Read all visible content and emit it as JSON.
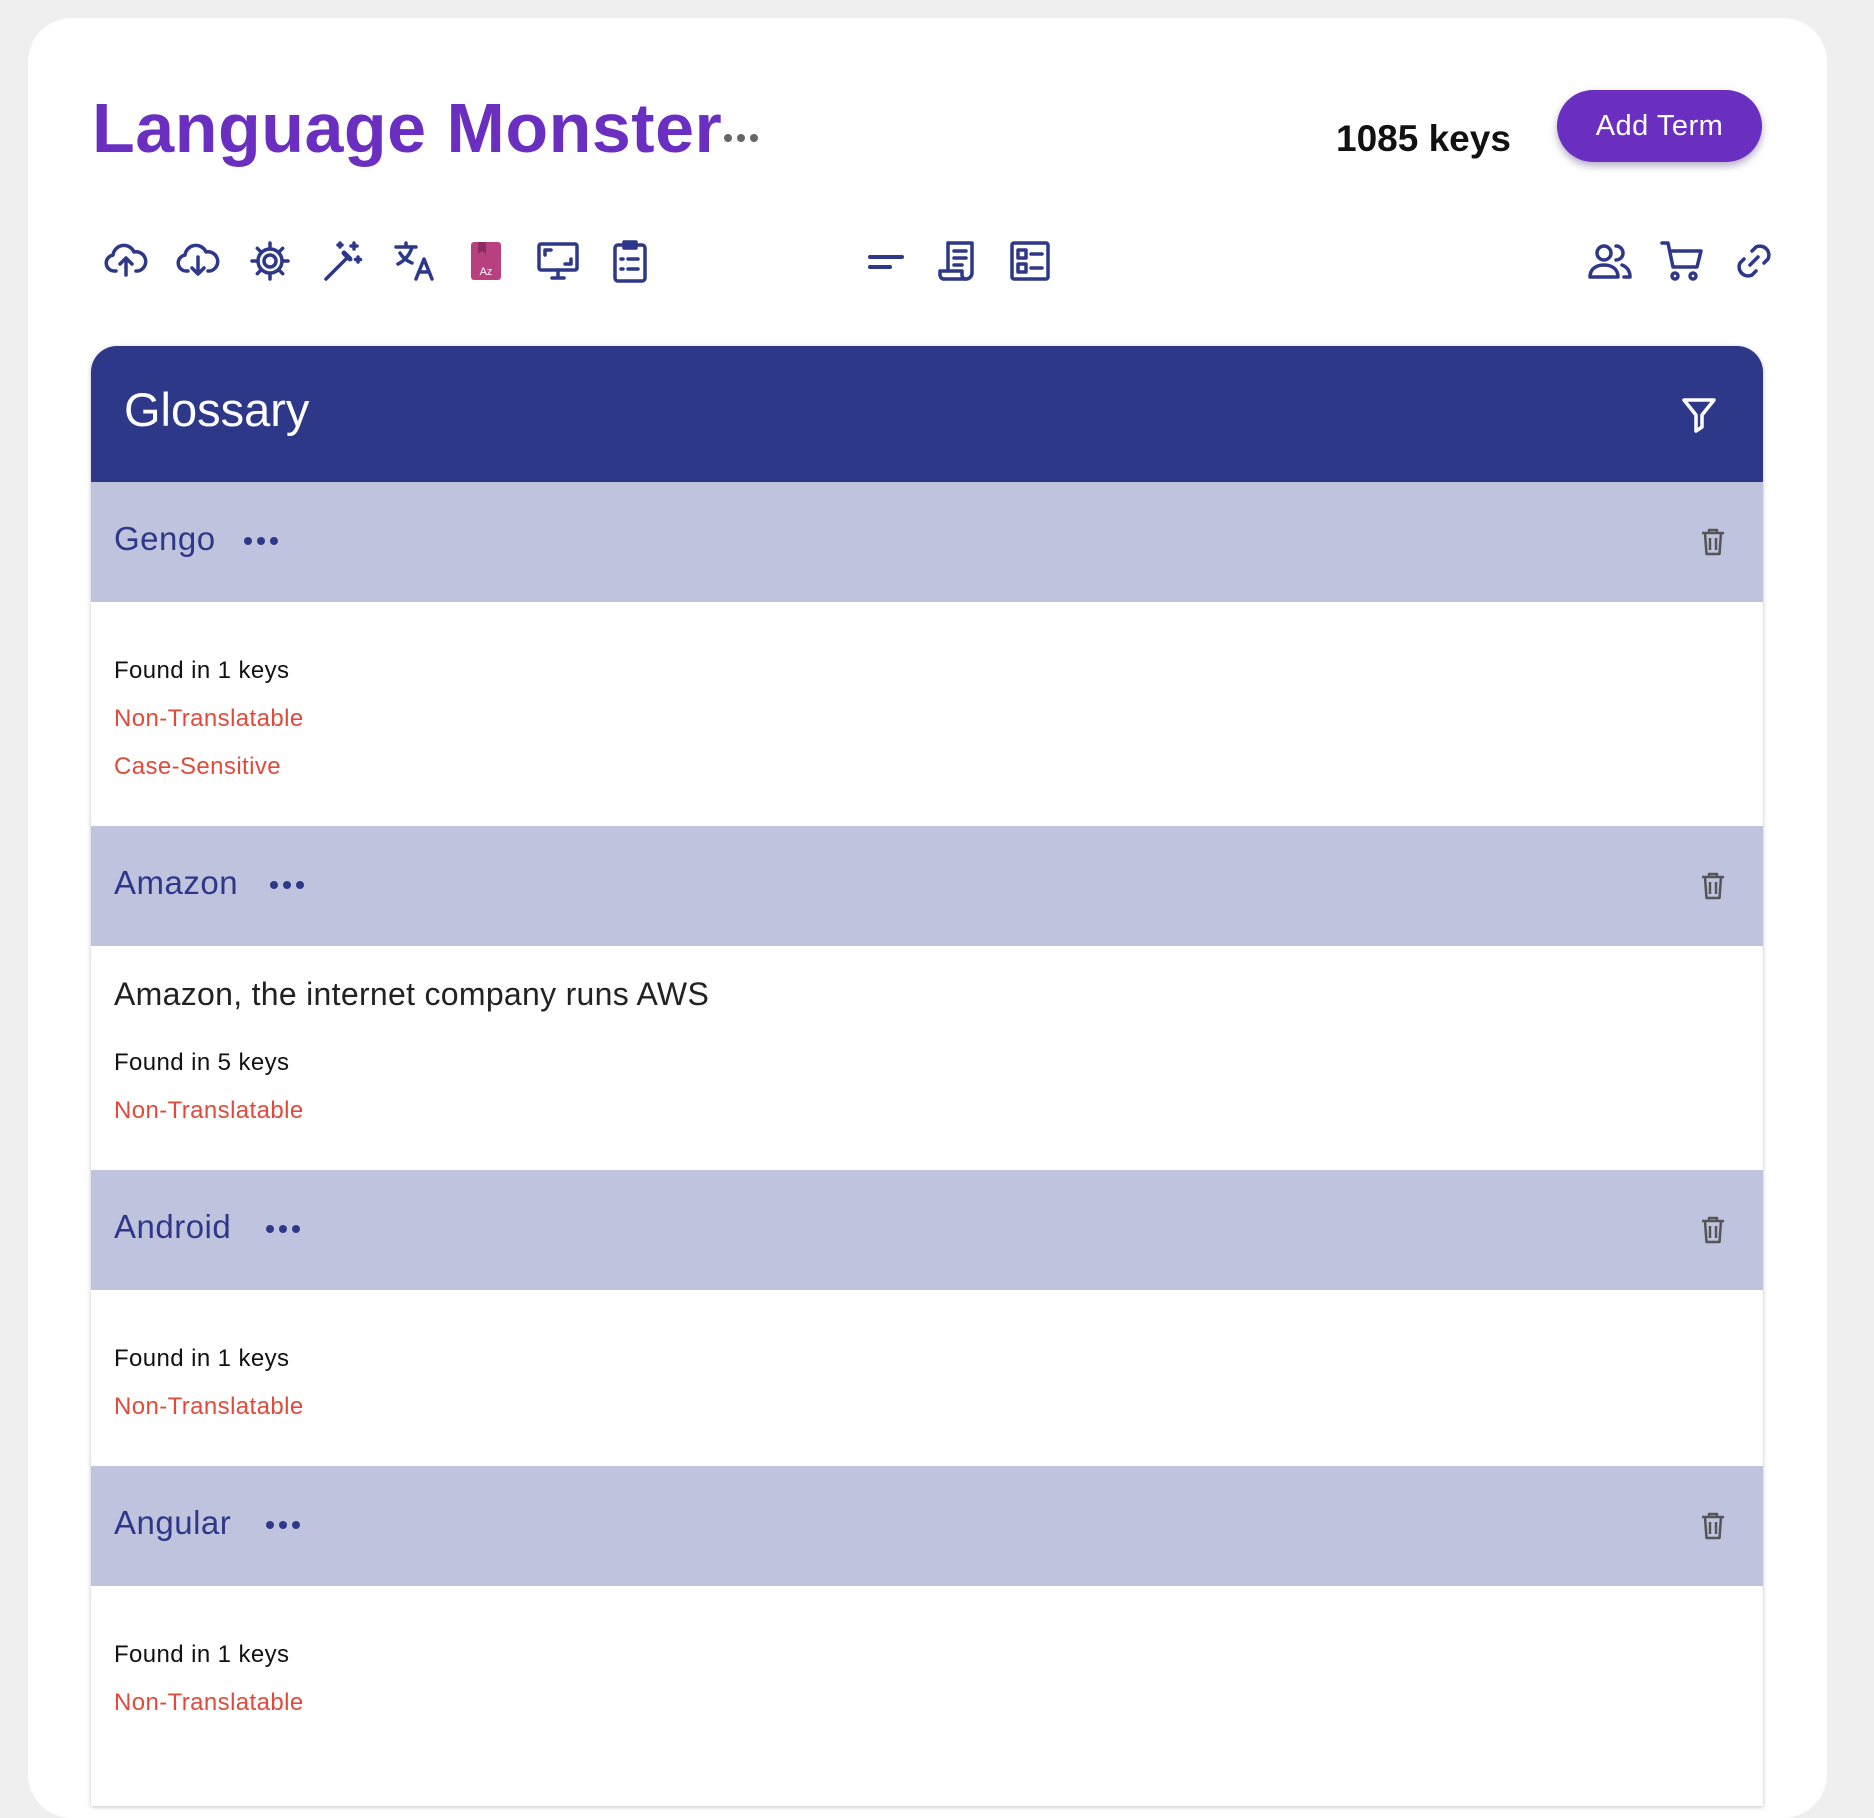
{
  "header": {
    "title": "Language Monster",
    "keys_count": "1085 keys",
    "add_term_label": "Add Term"
  },
  "toolbar": {
    "left_icons": [
      "cloud-upload-icon",
      "cloud-download-icon",
      "settings-sync-icon",
      "magic-wand-icon",
      "translate-icon",
      "dictionary-icon",
      "monitor-icon",
      "clipboard-list-icon"
    ],
    "middle_icons": [
      "short-text-icon",
      "script-icon",
      "form-layout-icon"
    ],
    "right_icons": [
      "people-icon",
      "cart-icon",
      "link-icon"
    ]
  },
  "glossary": {
    "title": "Glossary",
    "terms": [
      {
        "name": "Gengo",
        "description": "",
        "found_in": "Found in 1 keys",
        "non_translatable": "Non-Translatable",
        "case_sensitive": "Case-Sensitive"
      },
      {
        "name": "Amazon",
        "description": "Amazon, the internet company runs AWS",
        "found_in": "Found in 5 keys",
        "non_translatable": "Non-Translatable"
      },
      {
        "name": "Android",
        "description": "",
        "found_in": "Found in 1 keys",
        "non_translatable": "Non-Translatable"
      },
      {
        "name": "Angular",
        "description": "",
        "found_in": "Found in 1 keys",
        "non_translatable": "Non-Translatable"
      }
    ]
  },
  "colors": {
    "brand_purple": "#6a2fc0",
    "header_navy": "#2e3888",
    "term_header_bg": "#c0c3de",
    "flag_red": "#e04a3a",
    "icon_blue": "#2e3888",
    "dictionary_icon": "#b8407e"
  }
}
